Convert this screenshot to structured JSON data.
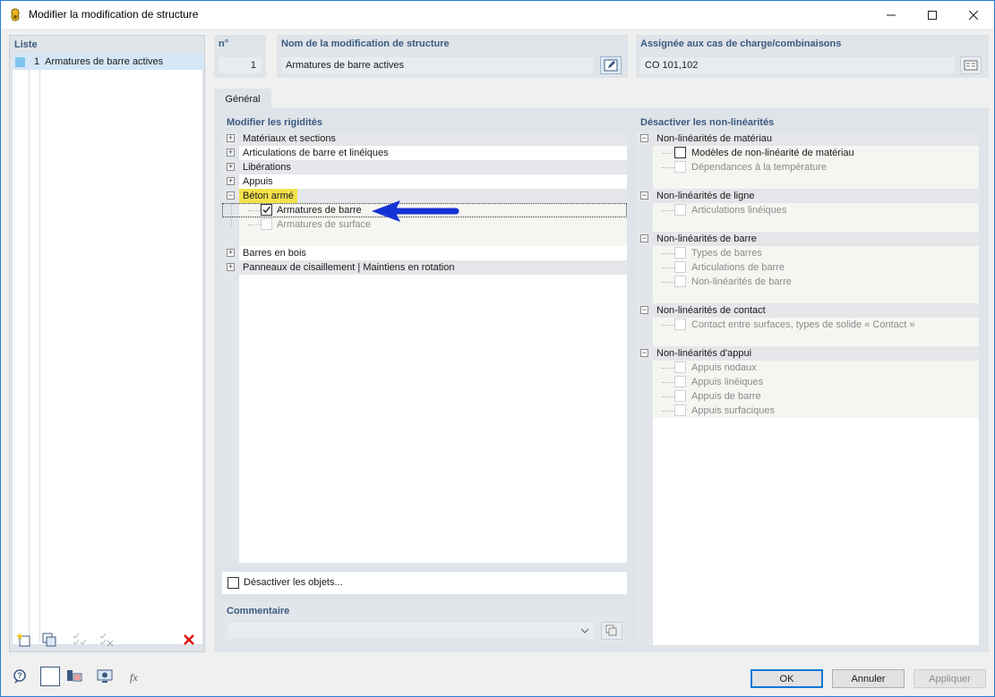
{
  "window": {
    "title": "Modifier la modification de structure"
  },
  "list": {
    "header": "Liste",
    "items": [
      {
        "number": "1",
        "label": "Armatures de barre actives",
        "color": "#7fc4ef"
      }
    ]
  },
  "header": {
    "number_label": "n°",
    "number_value": "1",
    "name_label": "Nom de la modification de structure",
    "name_value": "Armatures de barre actives",
    "assigned_label": "Assignée aux cas de charge/combinaisons",
    "assigned_value": "CO 101,102"
  },
  "tabs": [
    {
      "label": "Général"
    }
  ],
  "stiffness": {
    "title": "Modifier les rigidités",
    "items": [
      {
        "label": "Matériaux et sections",
        "expanded": false
      },
      {
        "label": "Articulations de barre et linéiques",
        "expanded": false
      },
      {
        "label": "Libérations",
        "expanded": false
      },
      {
        "label": "Appuis",
        "expanded": false
      },
      {
        "label": "Béton armé",
        "expanded": true,
        "highlighted": true,
        "children": [
          {
            "label": "Armatures de barre",
            "checked": true,
            "enabled": true
          },
          {
            "label": "Armatures de surface",
            "checked": false,
            "enabled": false
          }
        ]
      },
      {
        "label": "Barres en bois",
        "expanded": false
      },
      {
        "label": "Panneaux de cisaillement | Maintiens en rotation",
        "expanded": false
      }
    ]
  },
  "nonlinear": {
    "title": "Désactiver les non-linéarités",
    "groups": [
      {
        "label": "Non-linéarités de matériau",
        "children": [
          {
            "label": "Modèles de non-linéarité de matériau",
            "enabled": true
          },
          {
            "label": "Dépendances à la température",
            "enabled": false
          }
        ]
      },
      {
        "label": "Non-linéarités de ligne",
        "children": [
          {
            "label": "Articulations linéiques",
            "enabled": false
          }
        ]
      },
      {
        "label": "Non-linéarités de barre",
        "children": [
          {
            "label": "Types de barres",
            "enabled": false
          },
          {
            "label": "Articulations de barre",
            "enabled": false
          },
          {
            "label": "Non-linéarités de barre",
            "enabled": false
          }
        ]
      },
      {
        "label": "Non-linéarités de contact",
        "children": [
          {
            "label": "Contact entre surfaces, types de solide « Contact »",
            "enabled": false
          }
        ]
      },
      {
        "label": "Non-linéarités d'appui",
        "children": [
          {
            "label": "Appuis nodaux",
            "enabled": false
          },
          {
            "label": "Appuis linéiques",
            "enabled": false
          },
          {
            "label": "Appuis de barre",
            "enabled": false
          },
          {
            "label": "Appuis surfaciques",
            "enabled": false
          }
        ]
      }
    ]
  },
  "deactivate_objects": {
    "label": "Désactiver les objets...",
    "checked": false
  },
  "comment": {
    "label": "Commentaire",
    "value": ""
  },
  "buttons": {
    "ok": "OK",
    "cancel": "Annuler",
    "apply": "Appliquer"
  },
  "icons": [
    "app-icon",
    "minimize-icon",
    "maximize-icon",
    "close-icon",
    "edit-icon",
    "list-icon",
    "new-item-icon",
    "copy-icon",
    "check-all-icon",
    "uncheck-all-icon",
    "delete-icon",
    "help-icon",
    "color-swatch-icon",
    "display-icon",
    "view-icon",
    "function-icon",
    "arrow-annotation"
  ],
  "colors": {
    "highlight": "#f3e24a",
    "arrow": "#1433d6",
    "accent": "#0078d7",
    "delete": "#e01010"
  }
}
